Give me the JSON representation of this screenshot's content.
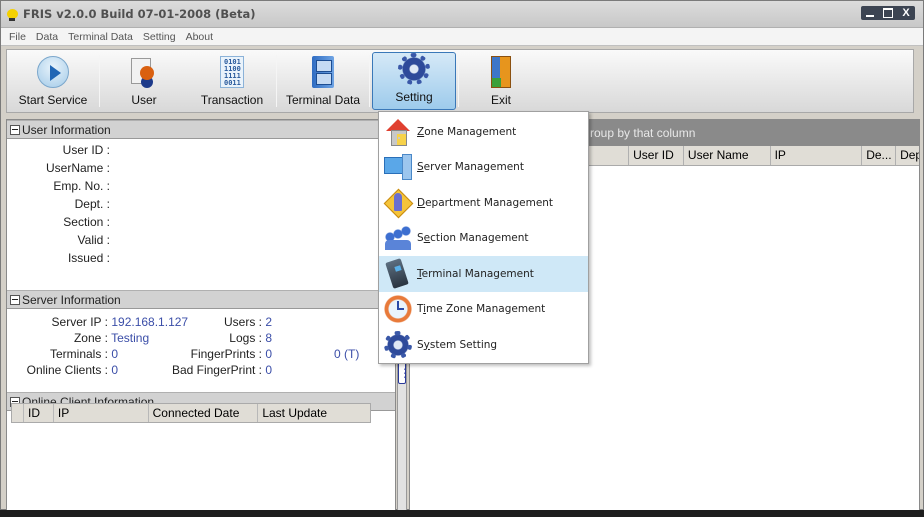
{
  "window": {
    "title": "FRIS v2.0.0  Build 07-01-2008 (Beta)",
    "controls": {
      "minimize": "minimize",
      "maximize": "maximize",
      "close": "X"
    }
  },
  "menubar": {
    "items": [
      "File",
      "Data",
      "Terminal Data",
      "Setting",
      "About"
    ]
  },
  "toolbar": {
    "buttons": [
      {
        "label": "Start Service",
        "icon": "play-icon"
      },
      {
        "label": "User",
        "icon": "user-icon"
      },
      {
        "label": "Transaction",
        "icon": "binary-data-icon",
        "glyph": "0101\n1100\n1111\n0011"
      },
      {
        "label": "Terminal Data",
        "icon": "file-cabinet-icon"
      },
      {
        "label": "Setting",
        "icon": "gear-icon",
        "active": true
      },
      {
        "label": "Exit",
        "icon": "door-exit-icon"
      }
    ]
  },
  "user_info": {
    "header": "User Information",
    "fields": [
      {
        "label": "User ID :",
        "value": ""
      },
      {
        "label": "UserName :",
        "value": ""
      },
      {
        "label": "Emp. No. :",
        "value": ""
      },
      {
        "label": "Dept. :",
        "value": ""
      },
      {
        "label": "Section :",
        "value": ""
      },
      {
        "label": "Valid :",
        "value": ""
      },
      {
        "label": "Issued :",
        "value": ""
      }
    ]
  },
  "server_info": {
    "header": "Server Information",
    "server_ip": {
      "label": "Server IP :",
      "value": "192.168.1.127"
    },
    "zone": {
      "label": "Zone :",
      "value": "Testing"
    },
    "terminals": {
      "label": "Terminals :",
      "value": "0"
    },
    "online_clients": {
      "label": "Online Clients :",
      "value": "0"
    },
    "users": {
      "label": "Users :",
      "value": "2"
    },
    "logs": {
      "label": "Logs :",
      "value": "8"
    },
    "fingerprints": {
      "label": "FingerPrints :",
      "value": "0"
    },
    "bad_fingerprint": {
      "label": "Bad FingerPrint :",
      "value": "0"
    },
    "fingerprints_t": "0 (T)"
  },
  "online_clients": {
    "header": "Online Client Information",
    "columns": [
      "ID",
      "IP",
      "Connected Date",
      "Last Update"
    ],
    "rows": []
  },
  "right_grid": {
    "group_hint": "roup by that column",
    "columns": [
      "",
      "User ID",
      "User Name",
      "IP",
      "De...",
      "Dep"
    ],
    "rows": []
  },
  "setting_menu": {
    "items": [
      {
        "label": "Zone Management",
        "mnemonic": "Z",
        "rest": "one Management",
        "icon": "zone-house-icon"
      },
      {
        "label": "Server Management",
        "mnemonic": "S",
        "rest": "erver Management",
        "icon": "server-icon"
      },
      {
        "label": "Department Management",
        "mnemonic": "D",
        "rest": "epartment Management",
        "icon": "department-icon"
      },
      {
        "label": "Section Management",
        "pre": "S",
        "mnemonic": "e",
        "rest": "ction Management",
        "icon": "section-group-icon"
      },
      {
        "label": "Terminal Management",
        "mnemonic": "T",
        "rest": "erminal Management",
        "icon": "terminal-device-icon",
        "highlighted": true
      },
      {
        "label": "Time Zone Management",
        "pre": "T",
        "mnemonic": "i",
        "rest": "me Zone Management",
        "icon": "clock-icon"
      },
      {
        "label": "System Setting",
        "pre": "S",
        "mnemonic": "y",
        "rest": "stem Setting",
        "icon": "system-gear-icon"
      }
    ]
  }
}
